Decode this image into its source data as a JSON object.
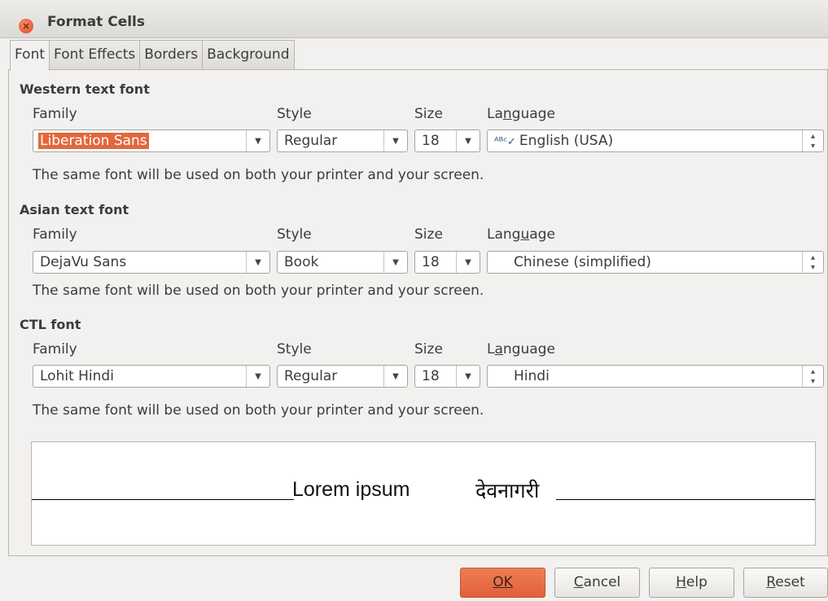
{
  "window": {
    "title": "Format Cells"
  },
  "tabs": [
    "Font",
    "Font Effects",
    "Borders",
    "Background"
  ],
  "labels": {
    "family": "Family",
    "style": "Style",
    "size": "Size",
    "language": "Language"
  },
  "western": {
    "heading": "Western text font",
    "family": "Liberation Sans",
    "style": "Regular",
    "size": "18",
    "language": "English (USA)",
    "info": "The same font will be used on both your printer and your screen."
  },
  "asian": {
    "heading": "Asian text font",
    "family": "DejaVu Sans",
    "style": "Book",
    "size": "18",
    "language": "Chinese (simplified)",
    "info": "The same font will be used on both your printer and your screen."
  },
  "ctl": {
    "heading": "CTL font",
    "family": "Lohit Hindi",
    "style": "Regular",
    "size": "18",
    "language": "Hindi",
    "info": "The same font will be used on both your printer and your screen."
  },
  "preview": {
    "text_western": "Lorem ipsum",
    "text_ctl": "देवनागरी"
  },
  "buttons": {
    "ok": "OK",
    "cancel": "Cancel",
    "help": "Help",
    "reset": "Reset"
  },
  "colors": {
    "accent": "#e2683c",
    "ok_button": "#e46a42",
    "dialog_bg": "#f2f1f0"
  },
  "icons": {
    "close": "close-icon",
    "spell": "spellcheck-icon",
    "dropdown": "chevron-down-icon",
    "spin": "spinner-icon"
  }
}
